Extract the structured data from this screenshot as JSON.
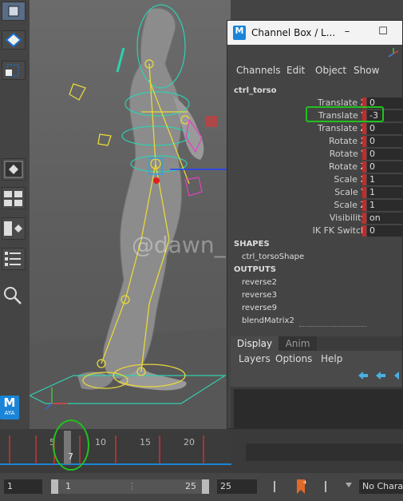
{
  "window": {
    "title": "Channel Box / L...",
    "minimize": "–",
    "maximize": "☐"
  },
  "menus": [
    "Channels",
    "Edit",
    "Object",
    "Show"
  ],
  "object_name": "ctrl_torso",
  "channels": [
    {
      "label": "Translate X",
      "value": "0"
    },
    {
      "label": "Translate Y",
      "value": "-3"
    },
    {
      "label": "Translate Z",
      "value": "0"
    },
    {
      "label": "Rotate X",
      "value": "0"
    },
    {
      "label": "Rotate Y",
      "value": "0"
    },
    {
      "label": "Rotate Z",
      "value": "0"
    },
    {
      "label": "Scale X",
      "value": "1"
    },
    {
      "label": "Scale Y",
      "value": "1"
    },
    {
      "label": "Scale Z",
      "value": "1"
    },
    {
      "label": "Visibility",
      "value": "on"
    },
    {
      "label": "IK FK Switch",
      "value": "0"
    }
  ],
  "shapes": {
    "header": "SHAPES",
    "items": [
      "ctrl_torsoShape"
    ]
  },
  "outputs": {
    "header": "OUTPUTS",
    "items": [
      "reverse2",
      "reverse3",
      "reverse9",
      "blendMatrix2"
    ]
  },
  "layer_panel": {
    "tabs": [
      "Display",
      "Anim"
    ],
    "menus": [
      "Layers",
      "Options",
      "Help"
    ]
  },
  "timeline": {
    "ticks": [
      "5",
      "10",
      "15",
      "20"
    ],
    "current_frame": "7"
  },
  "range": {
    "start": "1",
    "range_start": "1",
    "range_end": "25",
    "end": "25",
    "character": "No Chara"
  },
  "viewport": {
    "watermark": "@dawn_art"
  },
  "logo": {
    "letter": "M",
    "text": "AYA"
  },
  "colors": {
    "highlight_circle": "#22c01e",
    "channel_keyed": "#c42b2b",
    "rig_yellow": "#e8d83a",
    "rig_cyan": "#30d0b0",
    "timeline_key": "#c33",
    "playhead": "#777"
  }
}
